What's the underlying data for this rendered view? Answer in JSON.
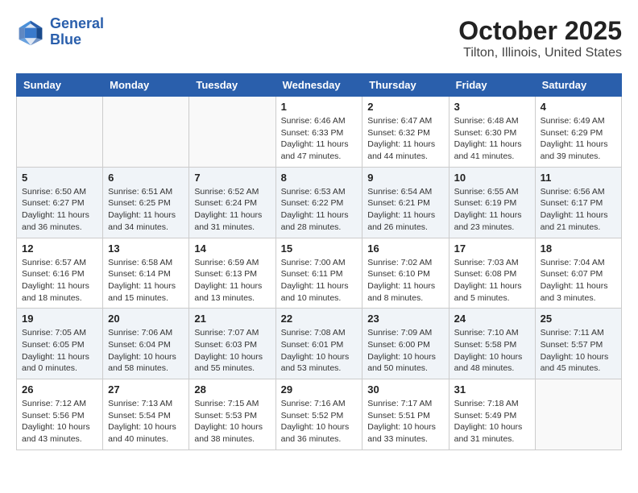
{
  "header": {
    "logo_line1": "General",
    "logo_line2": "Blue",
    "month": "October 2025",
    "location": "Tilton, Illinois, United States"
  },
  "weekdays": [
    "Sunday",
    "Monday",
    "Tuesday",
    "Wednesday",
    "Thursday",
    "Friday",
    "Saturday"
  ],
  "weeks": [
    [
      {
        "day": "",
        "info": ""
      },
      {
        "day": "",
        "info": ""
      },
      {
        "day": "",
        "info": ""
      },
      {
        "day": "1",
        "info": "Sunrise: 6:46 AM\nSunset: 6:33 PM\nDaylight: 11 hours and 47 minutes."
      },
      {
        "day": "2",
        "info": "Sunrise: 6:47 AM\nSunset: 6:32 PM\nDaylight: 11 hours and 44 minutes."
      },
      {
        "day": "3",
        "info": "Sunrise: 6:48 AM\nSunset: 6:30 PM\nDaylight: 11 hours and 41 minutes."
      },
      {
        "day": "4",
        "info": "Sunrise: 6:49 AM\nSunset: 6:29 PM\nDaylight: 11 hours and 39 minutes."
      }
    ],
    [
      {
        "day": "5",
        "info": "Sunrise: 6:50 AM\nSunset: 6:27 PM\nDaylight: 11 hours and 36 minutes."
      },
      {
        "day": "6",
        "info": "Sunrise: 6:51 AM\nSunset: 6:25 PM\nDaylight: 11 hours and 34 minutes."
      },
      {
        "day": "7",
        "info": "Sunrise: 6:52 AM\nSunset: 6:24 PM\nDaylight: 11 hours and 31 minutes."
      },
      {
        "day": "8",
        "info": "Sunrise: 6:53 AM\nSunset: 6:22 PM\nDaylight: 11 hours and 28 minutes."
      },
      {
        "day": "9",
        "info": "Sunrise: 6:54 AM\nSunset: 6:21 PM\nDaylight: 11 hours and 26 minutes."
      },
      {
        "day": "10",
        "info": "Sunrise: 6:55 AM\nSunset: 6:19 PM\nDaylight: 11 hours and 23 minutes."
      },
      {
        "day": "11",
        "info": "Sunrise: 6:56 AM\nSunset: 6:17 PM\nDaylight: 11 hours and 21 minutes."
      }
    ],
    [
      {
        "day": "12",
        "info": "Sunrise: 6:57 AM\nSunset: 6:16 PM\nDaylight: 11 hours and 18 minutes."
      },
      {
        "day": "13",
        "info": "Sunrise: 6:58 AM\nSunset: 6:14 PM\nDaylight: 11 hours and 15 minutes."
      },
      {
        "day": "14",
        "info": "Sunrise: 6:59 AM\nSunset: 6:13 PM\nDaylight: 11 hours and 13 minutes."
      },
      {
        "day": "15",
        "info": "Sunrise: 7:00 AM\nSunset: 6:11 PM\nDaylight: 11 hours and 10 minutes."
      },
      {
        "day": "16",
        "info": "Sunrise: 7:02 AM\nSunset: 6:10 PM\nDaylight: 11 hours and 8 minutes."
      },
      {
        "day": "17",
        "info": "Sunrise: 7:03 AM\nSunset: 6:08 PM\nDaylight: 11 hours and 5 minutes."
      },
      {
        "day": "18",
        "info": "Sunrise: 7:04 AM\nSunset: 6:07 PM\nDaylight: 11 hours and 3 minutes."
      }
    ],
    [
      {
        "day": "19",
        "info": "Sunrise: 7:05 AM\nSunset: 6:05 PM\nDaylight: 11 hours and 0 minutes."
      },
      {
        "day": "20",
        "info": "Sunrise: 7:06 AM\nSunset: 6:04 PM\nDaylight: 10 hours and 58 minutes."
      },
      {
        "day": "21",
        "info": "Sunrise: 7:07 AM\nSunset: 6:03 PM\nDaylight: 10 hours and 55 minutes."
      },
      {
        "day": "22",
        "info": "Sunrise: 7:08 AM\nSunset: 6:01 PM\nDaylight: 10 hours and 53 minutes."
      },
      {
        "day": "23",
        "info": "Sunrise: 7:09 AM\nSunset: 6:00 PM\nDaylight: 10 hours and 50 minutes."
      },
      {
        "day": "24",
        "info": "Sunrise: 7:10 AM\nSunset: 5:58 PM\nDaylight: 10 hours and 48 minutes."
      },
      {
        "day": "25",
        "info": "Sunrise: 7:11 AM\nSunset: 5:57 PM\nDaylight: 10 hours and 45 minutes."
      }
    ],
    [
      {
        "day": "26",
        "info": "Sunrise: 7:12 AM\nSunset: 5:56 PM\nDaylight: 10 hours and 43 minutes."
      },
      {
        "day": "27",
        "info": "Sunrise: 7:13 AM\nSunset: 5:54 PM\nDaylight: 10 hours and 40 minutes."
      },
      {
        "day": "28",
        "info": "Sunrise: 7:15 AM\nSunset: 5:53 PM\nDaylight: 10 hours and 38 minutes."
      },
      {
        "day": "29",
        "info": "Sunrise: 7:16 AM\nSunset: 5:52 PM\nDaylight: 10 hours and 36 minutes."
      },
      {
        "day": "30",
        "info": "Sunrise: 7:17 AM\nSunset: 5:51 PM\nDaylight: 10 hours and 33 minutes."
      },
      {
        "day": "31",
        "info": "Sunrise: 7:18 AM\nSunset: 5:49 PM\nDaylight: 10 hours and 31 minutes."
      },
      {
        "day": "",
        "info": ""
      }
    ]
  ]
}
